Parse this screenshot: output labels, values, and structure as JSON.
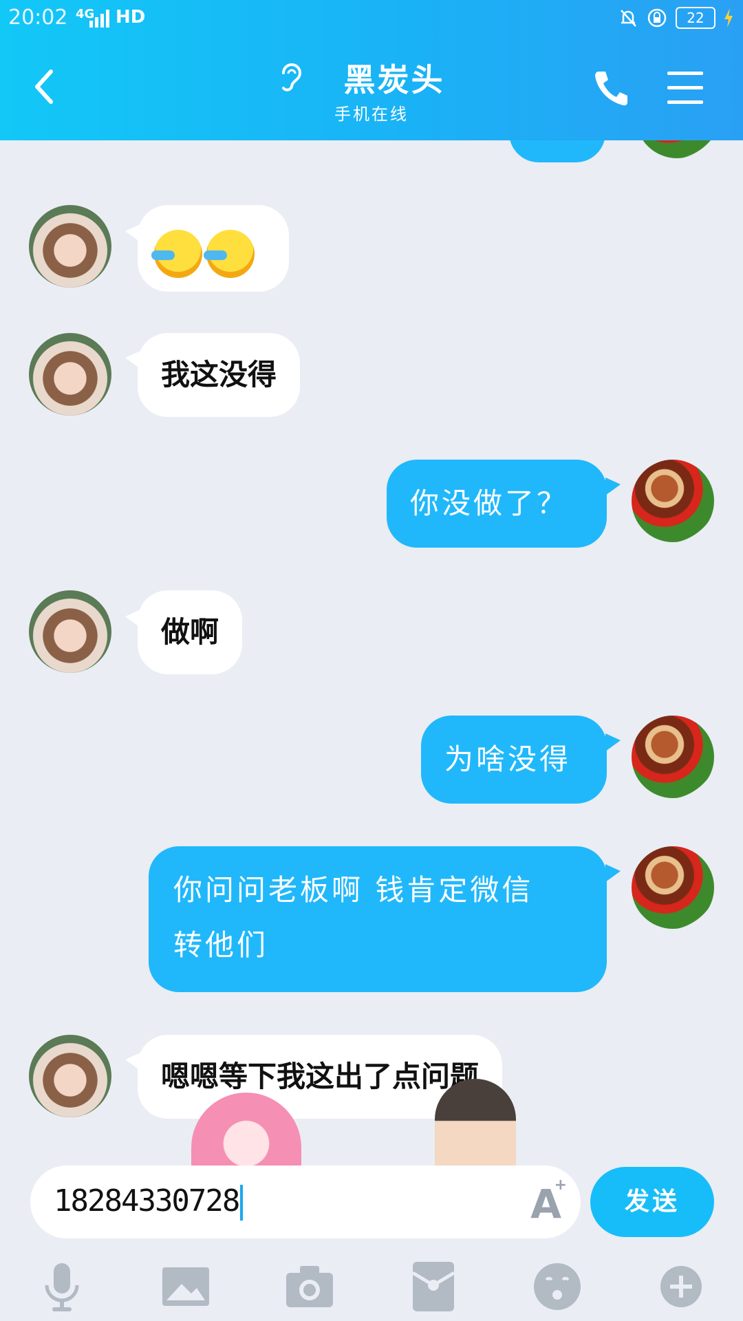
{
  "status_bar": {
    "time": "20:02",
    "network": "4G",
    "hd": "HD",
    "battery": "22"
  },
  "header": {
    "title": "黑炭头",
    "subtitle": "手机在线"
  },
  "messages": [
    {
      "from": "them",
      "type": "emoji",
      "text": ""
    },
    {
      "from": "them",
      "type": "text",
      "text": "我这没得"
    },
    {
      "from": "me",
      "type": "text",
      "text": "你没做了？"
    },
    {
      "from": "them",
      "type": "text",
      "text": "做啊"
    },
    {
      "from": "me",
      "type": "text",
      "text": "为啥没得"
    },
    {
      "from": "me",
      "type": "text",
      "text": "你问问老板啊  钱肯定微信",
      "text2": "转他们"
    },
    {
      "from": "them",
      "type": "text",
      "text": "嗯嗯等下我这出了点问题"
    }
  ],
  "input": {
    "value": "18284330728"
  },
  "send_label": "发送",
  "toolbar": [
    "mic-icon",
    "image-icon",
    "camera-icon",
    "red-packet-icon",
    "emoji-icon",
    "plus-icon"
  ],
  "colors": {
    "header": "#1ab2f6",
    "bubble_out": "#20b8fb",
    "background": "#eaedf4"
  }
}
